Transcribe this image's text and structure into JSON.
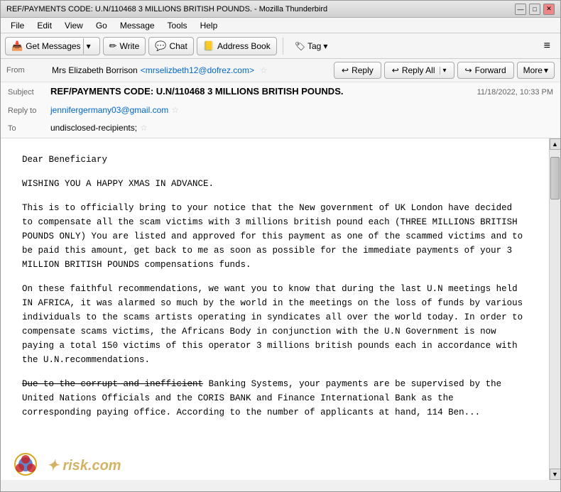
{
  "window": {
    "title": "REF/PAYMENTS CODE: U.N/110468 3 MILLIONS BRITISH POUNDS. - Mozilla Thunderbird",
    "app": "Mozilla Thunderbird"
  },
  "title_bar": {
    "title": "REF/PAYMENTS CODE: U.N/110468 3 MILLIONS BRITISH POUNDS. - Mozilla Thunderbird",
    "minimize": "—",
    "maximize": "□",
    "close": "✕"
  },
  "menu": {
    "items": [
      "File",
      "Edit",
      "View",
      "Go",
      "Message",
      "Tools",
      "Help"
    ]
  },
  "toolbar": {
    "get_messages": "Get Messages",
    "write": "Write",
    "chat": "Chat",
    "address_book": "Address Book",
    "tag": "Tag",
    "dropdown_arrow": "▾",
    "hamburger": "≡"
  },
  "email_actions": {
    "reply": "Reply",
    "reply_all": "Reply All",
    "forward": "Forward",
    "more": "More",
    "dropdown_arrow": "▾"
  },
  "email_header": {
    "from_label": "From",
    "from_name": "Mrs Elizabeth Borrison",
    "from_email": "<mrselizbeth12@dofrez.com>",
    "subject_label": "Subject",
    "subject": "REF/PAYMENTS CODE: U.N/110468 3 MILLIONS BRITISH POUNDS.",
    "reply_to_label": "Reply to",
    "reply_to": "jennifergermany03@gmail.com",
    "to_label": "To",
    "to_value": "undisclosed-recipients;",
    "date": "11/18/2022, 10:33 PM"
  },
  "email_body": {
    "greeting": "Dear Beneficiary",
    "para1": "WISHING YOU A HAPPY XMAS IN ADVANCE.",
    "para2": "This is to officially bring to your notice that the New government of UK London have decided to compensate all the scam victims with 3 millions british pound each (THREE MILLIONS BRITISH POUNDS ONLY) You are listed and approved for this payment as one of the scammed victims and to be paid this amount, get back to me as soon as possible for the immediate payments of your 3 MILLION BRITISH POUNDS compensations funds.",
    "para3": "On these faithful recommendations, we want you to know that during the last U.N meetings held IN AFRICA, it was alarmed so much by the world in the meetings on the loss of funds by various individuals to the scams artists operating in syndicates all over the world today. In order to compensate scams victims, the Africans Body in conjunction with the U.N Government is now paying a total 150 victims of this operator 3 millions british pounds each in accordance with the U.N.recommendations.",
    "para4": "Due to the corrupt and inefficient Banking Systems, your payments are be supervised by the United Nations Officials and the CORIS BANK and Finance International Bank as the corresponding paying office. According to the number of applicants at hand, 114 Ben..."
  },
  "watermark": {
    "text": "✦ risk.com"
  },
  "icons": {
    "get_messages": "📥",
    "write": "✏",
    "chat": "💬",
    "address_book": "📒",
    "reply": "↩",
    "reply_all": "↩↩",
    "forward": "↪",
    "tag": "🏷",
    "star": "★",
    "cursor": "▷"
  }
}
